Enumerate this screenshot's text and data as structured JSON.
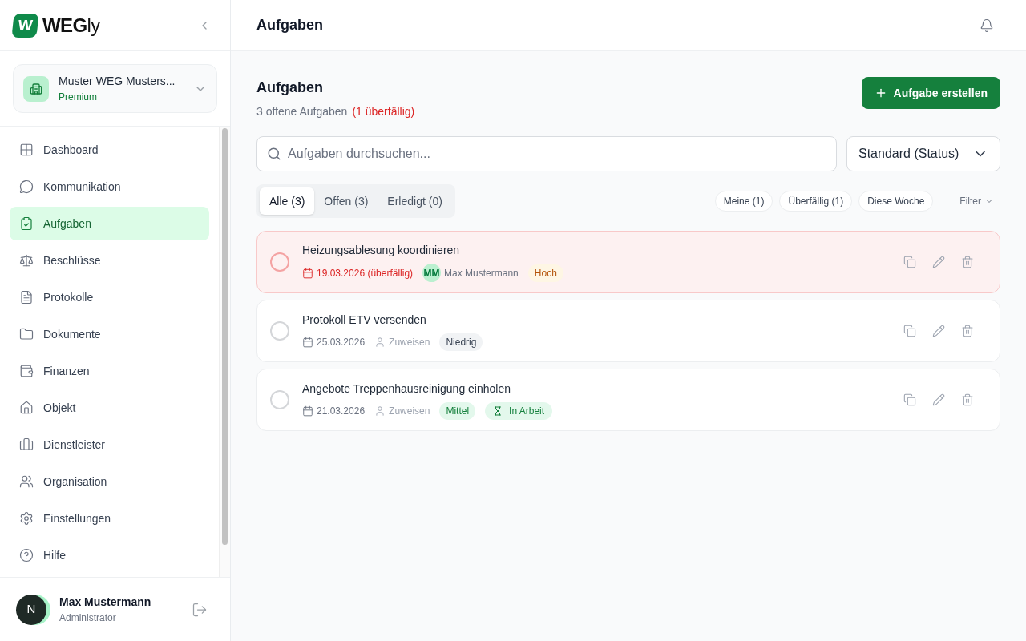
{
  "sidebar": {
    "logo_mark": "W",
    "logo_text": "**WEG**ly",
    "org": {
      "name": "Muster WEG Musters...",
      "plan": "Premium"
    },
    "items": [
      {
        "label": "Dashboard",
        "selected": false
      },
      {
        "label": "Kommunikation",
        "selected": false
      },
      {
        "label": "Aufgaben",
        "selected": true
      },
      {
        "label": "Beschlüsse",
        "selected": false
      },
      {
        "label": "Protokolle",
        "selected": false
      },
      {
        "label": "Dokumente",
        "selected": false
      },
      {
        "label": "Finanzen",
        "selected": false
      },
      {
        "label": "Objekt",
        "selected": false
      },
      {
        "label": "Dienstleister",
        "selected": false
      },
      {
        "label": "Organisation",
        "selected": false
      },
      {
        "label": "Einstellungen",
        "selected": false
      },
      {
        "label": "Hilfe",
        "selected": false
      }
    ],
    "user": {
      "initial": "N",
      "name": "Max Mustermann",
      "role": "Administrator"
    }
  },
  "header": {
    "title": "Aufgaben"
  },
  "page": {
    "title": "Aufgaben",
    "open_count": "3 offene Aufgaben",
    "overdue_count": "(1 überfällig)",
    "create_button": "Aufgabe erstellen",
    "search": {
      "placeholder": "Aufgaben durchsuchen..."
    },
    "sort": {
      "value": "Standard (Status)"
    },
    "tabs": [
      {
        "label": "Alle (3)",
        "selected": true
      },
      {
        "label": "Offen (3)",
        "selected": false
      },
      {
        "label": "Erledigt (0)",
        "selected": false
      }
    ],
    "quick_filters": [
      {
        "label": "Meine (1)",
        "selected": false
      },
      {
        "label": "Überfällig (1)",
        "selected": false
      },
      {
        "label": "Diese Woche",
        "selected": false
      }
    ],
    "filter": "Filter"
  },
  "tasks": [
    {
      "title": "Heizungsablesung koordinieren",
      "done": false,
      "overdue": true,
      "due": "19.03.2026 (überfällig)",
      "assignee": {
        "kind": "person",
        "initials": "MM",
        "name": "Max Mustermann"
      },
      "priority": {
        "kind": "high",
        "label": "Hoch"
      }
    },
    {
      "title": "Protokoll ETV versenden",
      "done": false,
      "overdue": false,
      "due": "25.03.2026",
      "assignee": {
        "kind": "unassigned",
        "name": "Zuweisen"
      },
      "priority": {
        "kind": "low",
        "label": "Niedrig"
      }
    },
    {
      "title": "Angebote Treppenhausreinigung einholen",
      "done": false,
      "overdue": false,
      "due": "21.03.2026",
      "assignee": {
        "kind": "unassigned",
        "name": "Zuweisen"
      },
      "priority": {
        "kind": "medium",
        "label": "Mittel"
      },
      "status": "In Arbeit"
    }
  ]
}
